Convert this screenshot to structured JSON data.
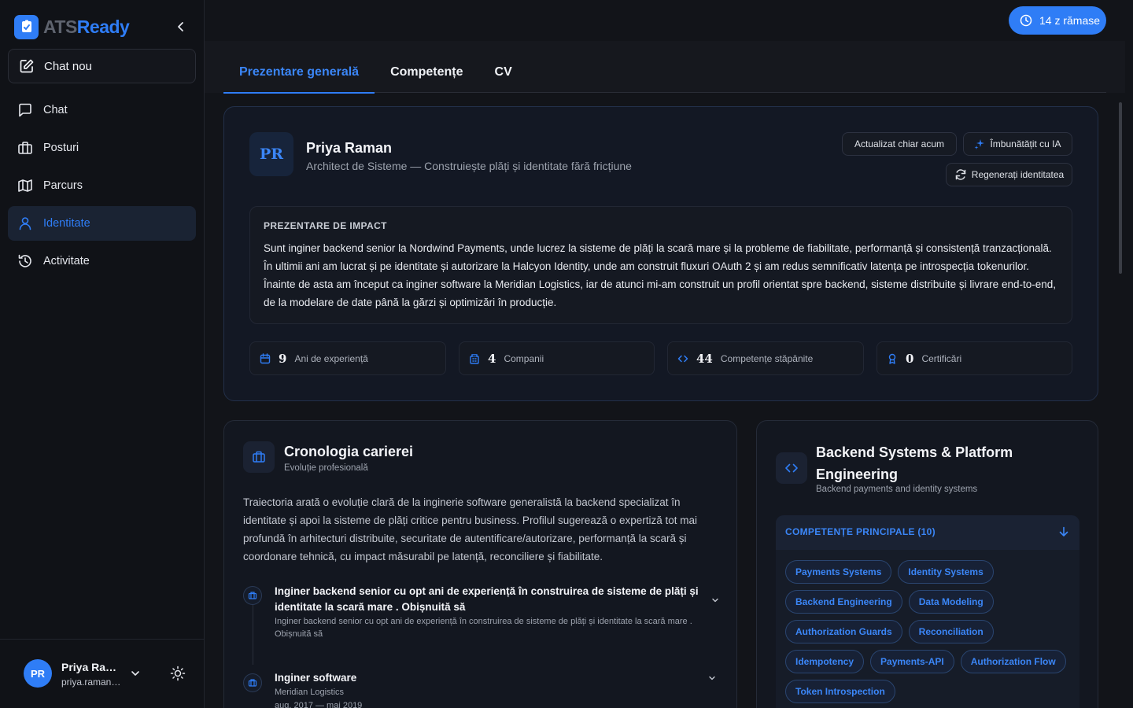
{
  "brand": {
    "name_part1": "ATS",
    "name_part2": "Ready"
  },
  "colors": {
    "accent": "#2f7df6",
    "background": "#121419",
    "sidebar": "#101217"
  },
  "sidebar": {
    "new_chat_label": "Chat nou",
    "items": [
      {
        "label": "Chat",
        "icon": "chat-icon"
      },
      {
        "label": "Posturi",
        "icon": "briefcase-icon"
      },
      {
        "label": "Parcurs",
        "icon": "map-icon"
      },
      {
        "label": "Identitate",
        "icon": "user-icon",
        "active": true
      },
      {
        "label": "Activitate",
        "icon": "history-icon"
      }
    ],
    "user": {
      "initials": "PR",
      "name": "Priya Ram...",
      "email": "priya.raman@..."
    }
  },
  "trial_badge": {
    "label": "14 z rămase"
  },
  "tabs": [
    {
      "label": "Prezentare generală",
      "active": true
    },
    {
      "label": "Competențe"
    },
    {
      "label": "CV"
    }
  ],
  "profile": {
    "initials": "PR",
    "name": "Priya Raman",
    "headline": "Architect de Sisteme — Construiește plăți și identitate fără fricțiune",
    "updated_label": "Actualizat chiar acum",
    "improve_label": "Îmbunătățit cu IA",
    "regenerate_label": "Regenerați identitatea",
    "impact_title": "PREZENTARE DE IMPACT",
    "impact_text": "Sunt inginer backend senior la Nordwind Payments, unde lucrez la sisteme de plăți la scară mare și la probleme de fiabilitate, performanță și consistență tranzacțională. În ultimii ani am lucrat și pe identitate și autorizare la Halcyon Identity, unde am construit fluxuri OAuth 2 și am redus semnificativ latența pe introspecția tokenurilor. Înainte de asta am început ca inginer software la Meridian Logistics, iar de atunci mi-am construit un profil orientat spre backend, sisteme distribuite și livrare end-to-end, de la modelare de date până la gărzi și optimizări în producție.",
    "stats": [
      {
        "value": "9",
        "label": "Ani de experiență",
        "icon": "calendar-icon"
      },
      {
        "value": "4",
        "label": "Companii",
        "icon": "building-icon"
      },
      {
        "value": "44",
        "label": "Competențe stăpânite",
        "icon": "code-icon"
      },
      {
        "value": "0",
        "label": "Certificări",
        "icon": "award-icon"
      }
    ]
  },
  "career": {
    "title": "Cronologia carierei",
    "subtitle": "Evoluție profesională",
    "description": "Traiectoria arată o evoluție clară de la inginerie software generalistă la backend specializat în identitate și apoi la sisteme de plăți critice pentru business. Profilul sugerează o expertiză tot mai profundă în arhitecturi distribuite, securitate de autentificare/autorizare, performanță la scară și coordonare tehnică, cu impact măsurabil pe latență, reconciliere și fiabilitate.",
    "entries": [
      {
        "title": "Inginer backend senior cu opt ani de experiență în construirea de sisteme de plăți și identitate la scară mare . Obișnuită să",
        "subtitle": "Inginer backend senior cu opt ani de experiență în construirea de sisteme de plăți și identitate la scară mare . Obișnuită să"
      },
      {
        "title": "Inginer software",
        "subtitle": "Meridian Logistics",
        "dates": "aug. 2017 — mai 2019"
      }
    ]
  },
  "skills": {
    "title": "Backend Systems & Platform Engineering",
    "subtitle": "Backend payments and identity systems",
    "section_label": "COMPETENȚE PRINCIPALE (10)",
    "chips": [
      "Payments Systems",
      "Identity Systems",
      "Backend Engineering",
      "Data Modeling",
      "Authorization Guards",
      "Reconciliation",
      "Idempotency",
      "Payments-API",
      "Authorization Flow",
      "Token Introspection"
    ]
  }
}
